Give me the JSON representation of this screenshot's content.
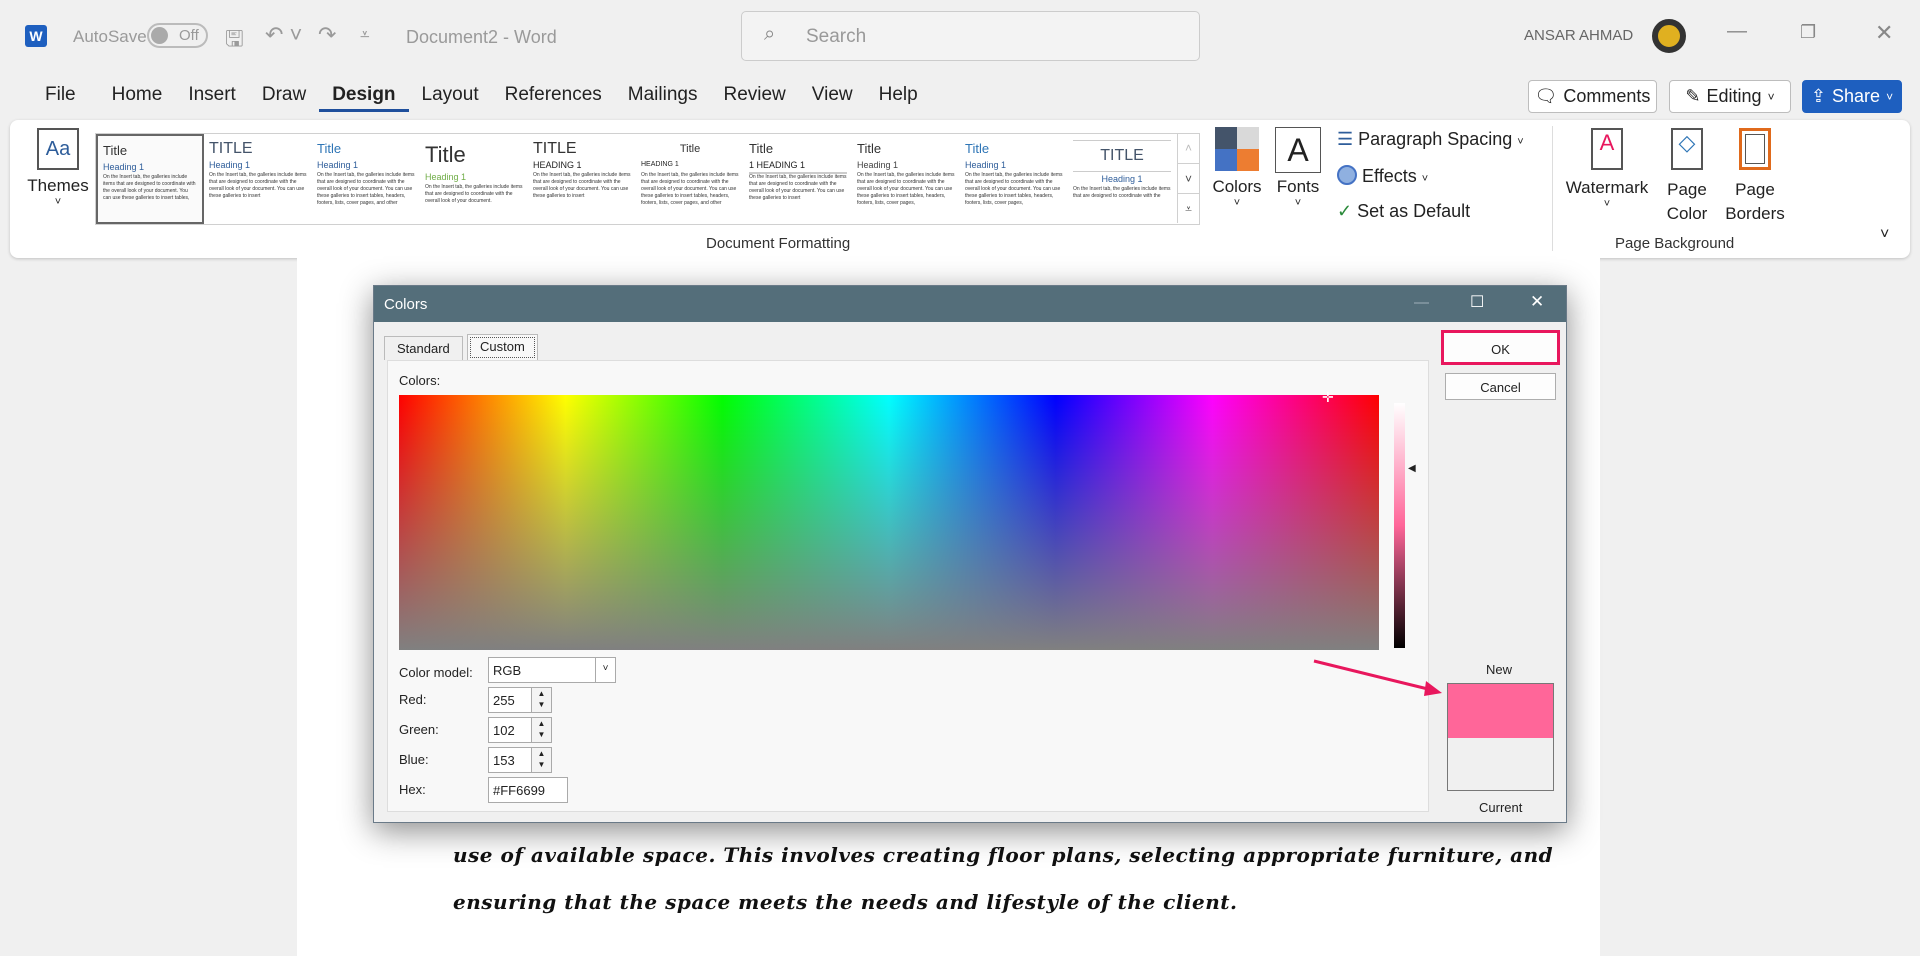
{
  "titlebar": {
    "autosave_label": "AutoSave",
    "autosave_state": "Off",
    "document_title": "Document2  -  Word",
    "search_placeholder": "Search",
    "user_name": "ANSAR AHMAD"
  },
  "tabs": [
    "File",
    "Home",
    "Insert",
    "Draw",
    "Design",
    "Layout",
    "References",
    "Mailings",
    "Review",
    "View",
    "Help"
  ],
  "active_tab": "Design",
  "header_buttons": {
    "comments": "Comments",
    "editing": "Editing",
    "share": "Share"
  },
  "ribbon": {
    "themes_label": "Themes",
    "gallery": [
      {
        "title": "Title",
        "heading": "Heading 1",
        "body": "On the Insert tab, the galleries include items that are designed to coordinate with the overall look of your document. You can use these galleries to insert tables,"
      },
      {
        "title": "TITLE",
        "heading": "Heading 1",
        "body": "On the Insert tab, the galleries include items that are designed to coordinate with the overall look of your document. You can use these galleries to insert"
      },
      {
        "title": "Title",
        "heading": "Heading 1",
        "body": "On the Insert tab, the galleries include items that are designed to coordinate with the overall look of your document. You can use these galleries to insert tables, headers, footers, lists, cover pages, and other"
      },
      {
        "title": "Title",
        "heading": "Heading 1",
        "body": "On the Insert tab, the galleries include items that are designed to coordinate with the overall look of your document."
      },
      {
        "title": "TITLE",
        "heading": "HEADING 1",
        "body": "On the Insert tab, the galleries include items that are designed to coordinate with the overall look of your document. You can use these galleries to insert"
      },
      {
        "title": "Title",
        "heading": "HEADING 1",
        "body": "On the Insert tab, the galleries include items that are designed to coordinate with the overall look of your document. You can use these galleries to insert tables, headers, footers, lists, cover pages, and other"
      },
      {
        "title": "Title",
        "heading": "1  HEADING 1",
        "body": "On the Insert tab, the galleries include items that are designed to coordinate with the overall look of your document. You can use these galleries to insert"
      },
      {
        "title": "Title",
        "heading": "Heading 1",
        "body": "On the Insert tab, the galleries include items that are designed to coordinate with the overall look of your document. You can use these galleries to insert tables, headers, footers, lists, cover pages,"
      },
      {
        "title": "Title",
        "heading": "Heading 1",
        "body": "On the Insert tab, the galleries include items that are designed to coordinate with the overall look of your document. You can use these galleries to insert tables, headers, footers, lists, cover pages,"
      },
      {
        "title": "TITLE",
        "heading": "Heading 1",
        "body": "On the Insert tab, the galleries include items that are designed to coordinate with the"
      }
    ],
    "colors_label": "Colors",
    "fonts_label": "Fonts",
    "paragraph_spacing": "Paragraph Spacing",
    "effects": "Effects",
    "set_default": "Set as Default",
    "group_document_formatting": "Document Formatting",
    "watermark": "Watermark",
    "page_color": "Page Color",
    "page_borders": "Page Borders",
    "group_page_background": "Page Background"
  },
  "document": {
    "lines": [
      "use of available space. This involves creating floor plans, selecting appropriate furniture, and",
      "ensuring that the space meets the needs and lifestyle of the client."
    ]
  },
  "dialog": {
    "title": "Colors",
    "tabs": [
      "Standard",
      "Custom"
    ],
    "active_tab": "Custom",
    "colors_label": "Colors:",
    "color_model_label": "Color model:",
    "color_model": "RGB",
    "red_label": "Red:",
    "red": "255",
    "green_label": "Green:",
    "green": "102",
    "blue_label": "Blue:",
    "blue": "153",
    "hex_label": "Hex:",
    "hex": "#FF6699",
    "ok": "OK",
    "cancel": "Cancel",
    "new_label": "New",
    "current_label": "Current",
    "new_color": "#FF6699",
    "current_color": "#F0F0F0",
    "highlight_color": "#E8175D"
  }
}
